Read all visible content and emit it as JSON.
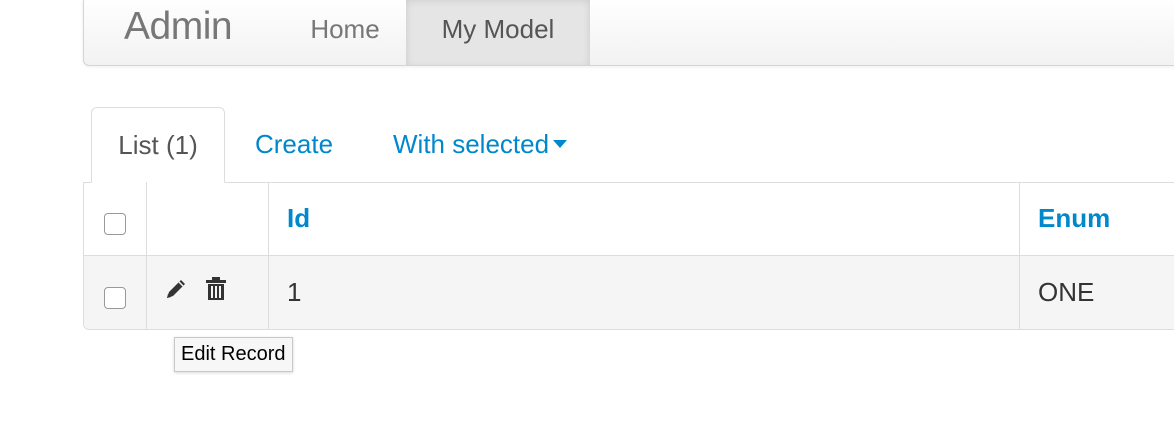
{
  "navbar": {
    "brand": "Admin",
    "items": [
      {
        "label": "Home",
        "active": false
      },
      {
        "label": "My Model",
        "active": true
      }
    ]
  },
  "tabs": {
    "list": "List (1)",
    "create": "Create",
    "with_selected": "With selected"
  },
  "table": {
    "columns": [
      "Id",
      "Enum"
    ],
    "rows": [
      {
        "id": "1",
        "enum": "ONE"
      }
    ]
  },
  "icons": {
    "edit": "pencil-icon",
    "delete": "trash-icon"
  },
  "tooltip": "Edit Record",
  "colors": {
    "link": "#0088cc",
    "nav_active_bg": "#e5e5e5"
  }
}
